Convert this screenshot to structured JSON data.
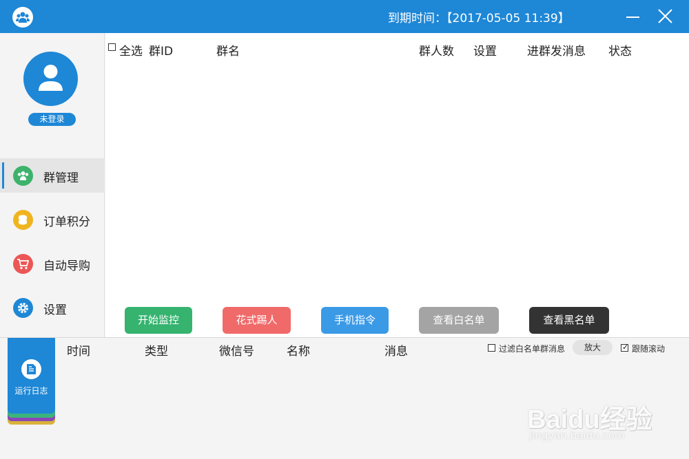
{
  "titlebar": {
    "expiry_text": "到期时间：【2017-05-05 11:39】",
    "logo_icon": "people-icon",
    "minimize_icon": "minimize-icon",
    "close_icon": "close-icon",
    "color": "#1e87d6"
  },
  "sidebar": {
    "avatar_icon": "user-icon",
    "login_status": "未登录",
    "items": [
      {
        "label": "群管理",
        "icon": "group-icon",
        "color": "#3db26b",
        "active": true
      },
      {
        "label": "订单积分",
        "icon": "coins-icon",
        "color": "#f0b41e",
        "active": false
      },
      {
        "label": "自动导购",
        "icon": "cart-icon",
        "color": "#ec5656",
        "active": false
      },
      {
        "label": "设置",
        "icon": "gear-icon",
        "color": "#1e87d6",
        "active": false
      }
    ]
  },
  "group_table": {
    "select_all": "全选",
    "columns": [
      "群ID",
      "群名",
      "群人数",
      "设置",
      "进群发消息",
      "状态"
    ],
    "rows": []
  },
  "actions": [
    {
      "label": "开始监控",
      "color": "#35b36f"
    },
    {
      "label": "花式踢人",
      "color": "#f06a6a"
    },
    {
      "label": "手机指令",
      "color": "#3b9ae6"
    },
    {
      "label": "查看白名单",
      "color": "#a4a4a4"
    },
    {
      "label": "查看黑名单",
      "color": "#333333"
    }
  ],
  "log": {
    "tab_label": "运行日志",
    "tab_icon": "document-icon",
    "tab_layer_colors": [
      "#d9b33a",
      "#8b45b8",
      "#3bb57c"
    ],
    "columns": [
      "时间",
      "类型",
      "微信号",
      "名称",
      "消息"
    ],
    "filter_label": "过滤白名单群消息",
    "filter_checked": false,
    "zoom_label": "放大",
    "follow_label": "跟随滚动",
    "follow_checked": true
  },
  "watermark": {
    "brand": "Baidu经验",
    "url": "jingyan.baidu.com"
  }
}
